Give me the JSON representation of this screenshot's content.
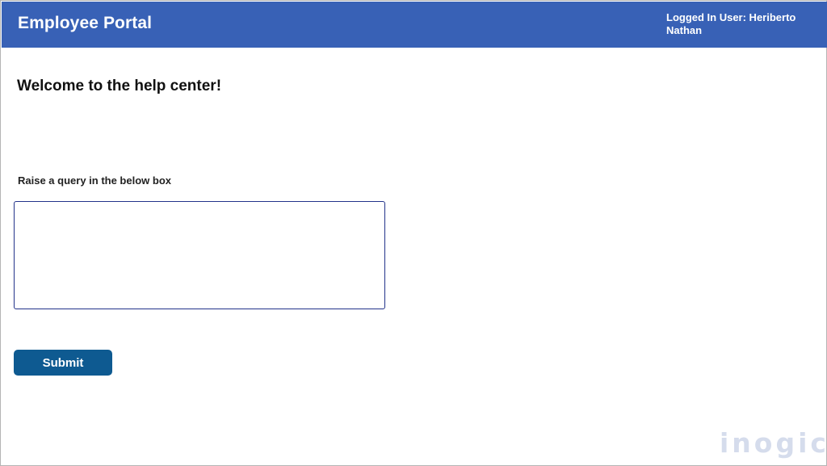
{
  "header": {
    "title": "Employee Portal",
    "user_label": "Logged In User: Heriberto Nathan"
  },
  "main": {
    "welcome": "Welcome to the help center!",
    "query_label": "Raise a query in the below box",
    "query_value": "",
    "submit_label": "Submit"
  },
  "watermark": {
    "text": "inogic"
  },
  "colors": {
    "header_bg": "#3861b6",
    "submit_bg": "#0e5a91",
    "textbox_border": "#23338a"
  }
}
